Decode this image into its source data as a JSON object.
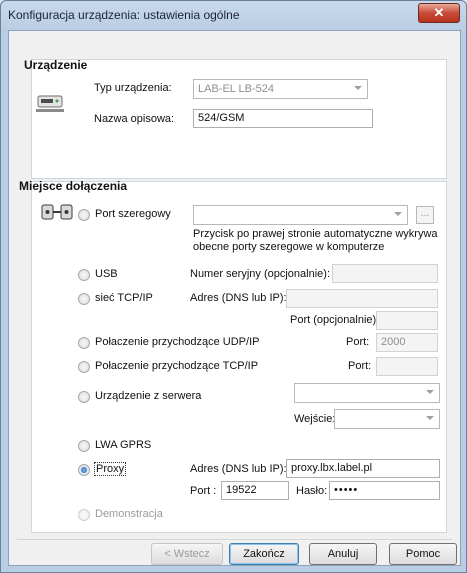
{
  "window": {
    "title": "Konfiguracja urządzenia: ustawienia ogólne",
    "close": "✕"
  },
  "device": {
    "group_title": "Urządzenie",
    "type_label": "Typ urządzenia:",
    "type_value": "LAB-EL LB-524",
    "name_label": "Nazwa opisowa:",
    "name_value": "524/GSM"
  },
  "attach": {
    "group_title": "Miejsce dołączenia",
    "serial_label": "Port szeregowy",
    "serial_value": "",
    "serial_hint_1": "Przycisk po prawej stronie automatyczne wykrywa",
    "serial_hint_2": "obecne porty szeregowe w komputerze",
    "usb_label": "USB",
    "serial_no_label": "Numer seryjny (opcjonalnie):",
    "serial_no_value": "",
    "tcpip_label": "sieć TCP/IP",
    "addr_label": "Adres (DNS lub IP):",
    "addr_value": "",
    "port_opt_label": "Port (opcjonalnie):",
    "port_opt_value": "",
    "udp_label": "Połaczenie przychodzące UDP/IP",
    "udp_port_label": "Port:",
    "udp_port_value": "2000",
    "tcp_in_label": "Połaczenie przychodzące TCP/IP",
    "tcp_port_label": "Port:",
    "tcp_port_value": "",
    "server_label": "Urządzenie z serwera",
    "server_value": "",
    "input_label": "Wejście:",
    "input_value": "",
    "gprs_label": "LWA GPRS",
    "proxy_label": "Proxy",
    "proxy_addr_label": "Adres (DNS lub IP):",
    "proxy_addr_value": "proxy.lbx.label.pl",
    "proxy_port_label": "Port :",
    "proxy_port_value": "19522",
    "password_label": "Hasło:",
    "password_value": "•••••",
    "demo_label": "Demonstracja",
    "selected": "Proxy"
  },
  "buttons": {
    "back": "< Wstecz",
    "finish": "Zakończ",
    "cancel": "Anuluj",
    "help": "Pomoc",
    "browse": "..."
  }
}
